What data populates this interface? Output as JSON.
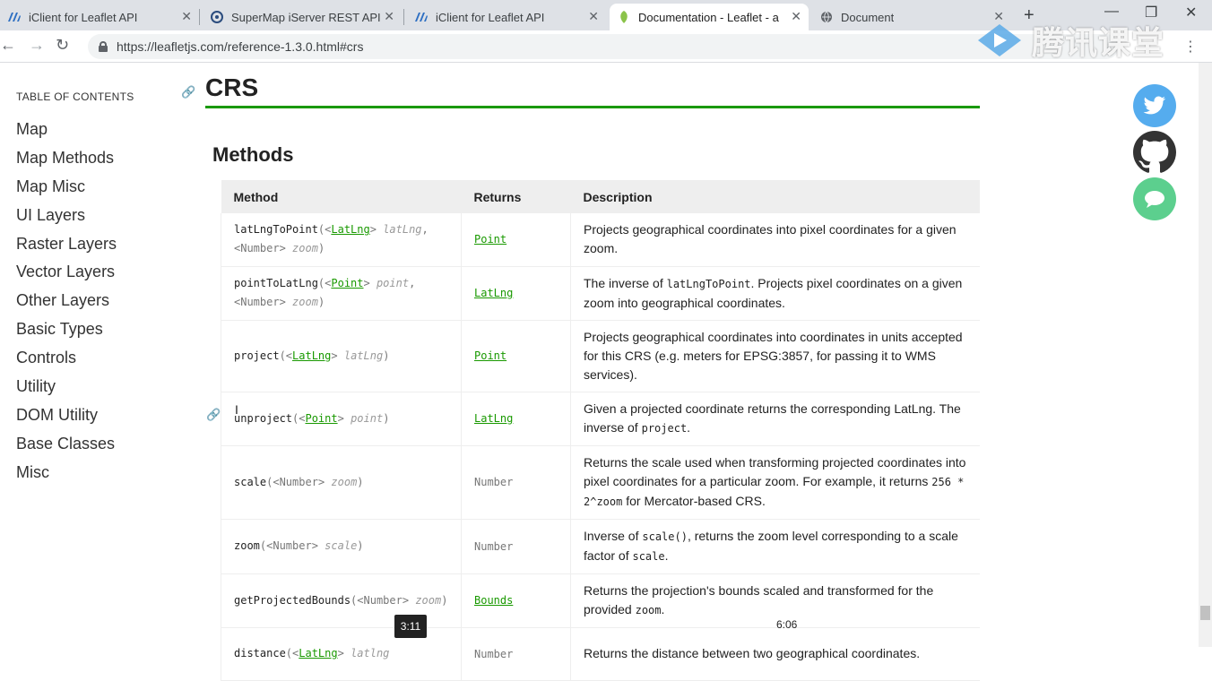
{
  "browser": {
    "tabs": [
      {
        "title": "iClient for Leaflet API",
        "favicon": "iclient-icon"
      },
      {
        "title": "SuperMap iServer REST API",
        "favicon": "supermap-icon"
      },
      {
        "title": "iClient for Leaflet API",
        "favicon": "iclient-icon"
      },
      {
        "title": "Documentation - Leaflet - a",
        "favicon": "leaflet-icon"
      },
      {
        "title": "Document",
        "favicon": "globe-icon"
      }
    ],
    "url": "https://leafletjs.com/reference-1.3.0.html#crs"
  },
  "watermark": {
    "text": "腾讯课堂"
  },
  "toc": {
    "heading": "TABLE OF CONTENTS",
    "items": [
      "Map",
      "Map Methods",
      "Map Misc",
      "UI Layers",
      "Raster Layers",
      "Vector Layers",
      "Other Layers",
      "Basic Types",
      "Controls",
      "Utility",
      "DOM Utility",
      "Base Classes",
      "Misc"
    ]
  },
  "content": {
    "section_title": "CRS",
    "subsection_title": "Methods",
    "table_headers": [
      "Method",
      "Returns",
      "Description"
    ]
  },
  "rows": {
    "r1": {
      "name": "latLngToPoint",
      "t1": "LatLng",
      "a1": "latLng",
      "t2": "Number",
      "a2": "zoom",
      "ret": "Point",
      "desc": "Projects geographical coordinates into pixel coordinates for a given zoom."
    },
    "r2": {
      "name": "pointToLatLng",
      "t1": "Point",
      "a1": "point",
      "t2": "Number",
      "a2": "zoom",
      "ret": "LatLng",
      "desc1": "The inverse of ",
      "code1": "latLngToPoint",
      "desc2": ". Projects pixel coordinates on a given zoom into geographical coordinates."
    },
    "r3": {
      "name": "project",
      "t1": "LatLng",
      "a1": "latLng",
      "ret": "Point",
      "desc": "Projects geographical coordinates into coordinates in units accepted for this CRS (e.g. meters for EPSG:3857, for passing it to WMS services)."
    },
    "r4": {
      "name": "unproject",
      "t1": "Point",
      "a1": "point",
      "ret": "LatLng",
      "desc1": "Given a projected coordinate returns the corresponding LatLng. The inverse of ",
      "code1": "project",
      "desc2": "."
    },
    "r5": {
      "name": "scale",
      "t1": "Number",
      "a1": "zoom",
      "ret": "Number",
      "desc1": "Returns the scale used when transforming projected coordinates into pixel coordinates for a particular zoom. For example, it returns ",
      "code1": "256 * 2^zoom",
      "desc2": " for Mercator-based CRS."
    },
    "r6": {
      "name": "zoom",
      "t1": "Number",
      "a1": "scale",
      "ret": "Number",
      "desc1": "Inverse of ",
      "code1": "scale()",
      "desc2": ", returns the zoom level corresponding to a scale factor of ",
      "code2": "scale",
      "desc3": "."
    },
    "r7": {
      "name": "getProjectedBounds",
      "t1": "Number",
      "a1": "zoom",
      "ret": "Bounds",
      "desc1": "Returns the projection's bounds scaled and transformed for the provided ",
      "code1": "zoom",
      "desc2": "."
    },
    "r8": {
      "name": "distance",
      "t1": "LatLng",
      "a1": "latlng",
      "ret": "Number",
      "desc": "Returns the distance between two geographical coordinates."
    }
  },
  "video": {
    "current_time": "3:11",
    "duration": "6:06"
  }
}
